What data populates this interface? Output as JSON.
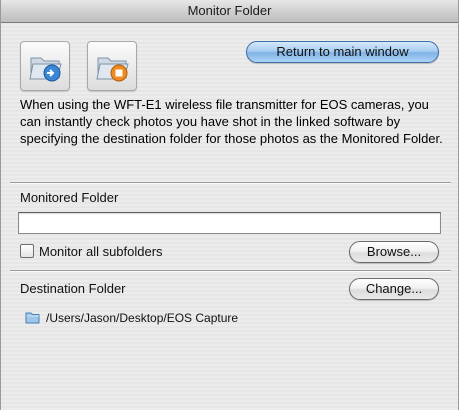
{
  "window": {
    "title": "Monitor Folder"
  },
  "toolbar": {
    "buttons": [
      {
        "icon": "folder-link-icon"
      },
      {
        "icon": "folder-stop-icon"
      }
    ],
    "return_label": "Return to main window"
  },
  "description": "When using the WFT-E1 wireless file transmitter for EOS cameras, you can instantly check photos you have shot in the linked software by specifying the destination folder for those photos as the Monitored Folder.",
  "monitored": {
    "heading": "Monitored Folder",
    "value": "",
    "checkbox_label": "Monitor all subfolders",
    "checkbox_checked": false,
    "browse_label": "Browse..."
  },
  "destination": {
    "heading": "Destination Folder",
    "change_label": "Change...",
    "path": "/Users/Jason/Desktop/EOS Capture"
  },
  "colors": {
    "accent": "#7fb3e6",
    "folder": "#9cc6ea"
  }
}
